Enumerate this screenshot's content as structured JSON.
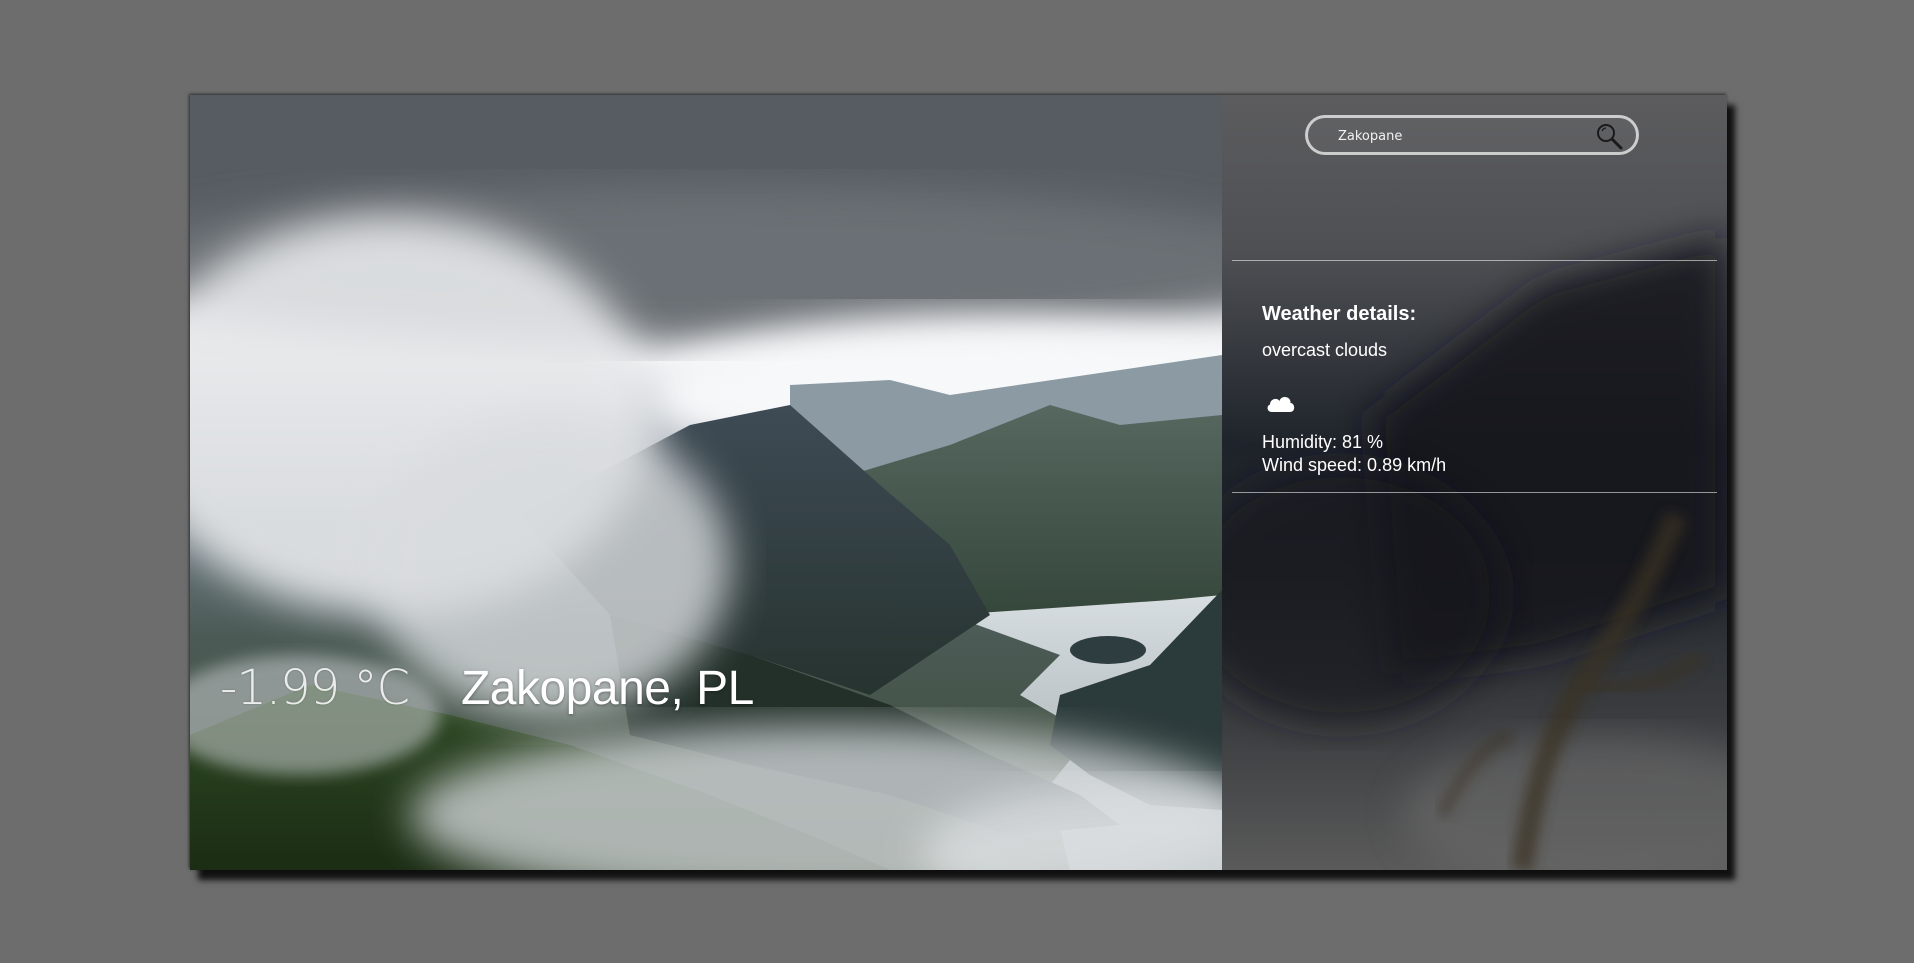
{
  "current": {
    "temperature": "-1.99 °C",
    "location": "Zakopane, PL"
  },
  "search": {
    "value": "Zakopane",
    "button_icon": "magnifier-icon"
  },
  "details": {
    "title": "Weather details:",
    "description": "overcast clouds",
    "condition_icon": "cloud-icon",
    "humidity": "Humidity: 81 %",
    "wind": "Wind speed: 0.89 km/h"
  },
  "colors": {
    "page_background": "#6d6d6d",
    "text": "#ffffff",
    "search_border": "#e1e1e1"
  }
}
